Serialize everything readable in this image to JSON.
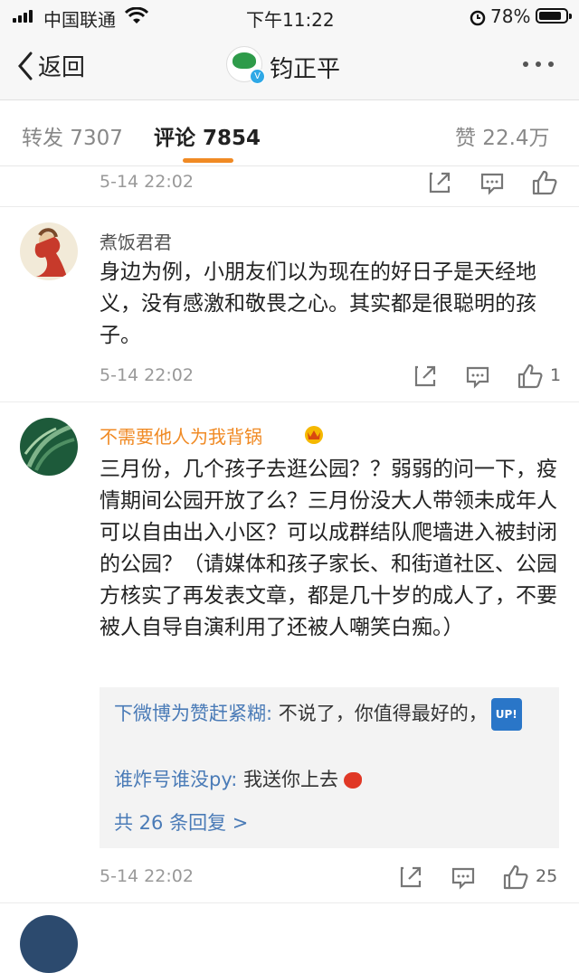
{
  "status_bar": {
    "carrier": "中国联通",
    "time": "下午11:22",
    "battery": "78%",
    "battery_level": 0.78
  },
  "nav": {
    "back_label": "返回",
    "title": "钧正平",
    "icons": [
      "chevron-left-icon",
      "more-dots-icon"
    ]
  },
  "tabs": [
    {
      "label": "转发 7307"
    },
    {
      "label": "评论 7854"
    },
    {
      "label": "赞 22.4万"
    }
  ],
  "colors": {
    "accent": "#f08a24",
    "link": "#4a7bb7",
    "vip_name": "#f08a24"
  },
  "comments": [
    {
      "time": "5-14 22:02"
    },
    {
      "username": "煮饭君君",
      "text": "身边为例，小朋友们以为现在的好日子是天经地义，没有感激和敬畏之心。其实都是很聪明的孩子。",
      "time": "5-14 22:02",
      "likes": "1"
    },
    {
      "username": "不需要他人为我背锅",
      "text": "三月份，几个孩子去逛公园？？弱弱的问一下，疫情期间公园开放了么？三月份没大人带领未成年人可以自由出入小区？可以成群结队爬墙进入被封闭的公园？（请媒体和孩子家长、和街道社区、公园方核实了再发表文章，都是几十岁的成人了，不要被人自导自演利用了还被人嘲笑白痴。）",
      "time": "5-14 22:02",
      "likes": "25",
      "replies": [
        {
          "name": "下微博为赞赶紧糊:",
          "text": " 不说了，你值得最好的，",
          "badge": "UP!"
        },
        {
          "name": "谁炸号谁没py:",
          "text": " 我送你上去"
        }
      ],
      "more_replies": "共 26 条回复 >"
    }
  ]
}
